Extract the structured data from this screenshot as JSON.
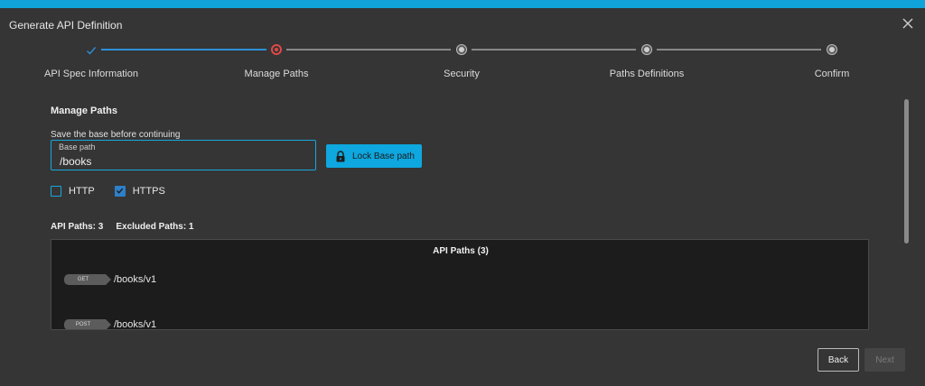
{
  "window": {
    "title": "Generate API Definition"
  },
  "stepper": {
    "steps": [
      {
        "label": "API Spec Information",
        "state": "done"
      },
      {
        "label": "Manage Paths",
        "state": "current"
      },
      {
        "label": "Security",
        "state": "pending"
      },
      {
        "label": "Paths Definitions",
        "state": "pending"
      },
      {
        "label": "Confirm",
        "state": "pending"
      }
    ]
  },
  "manage_paths": {
    "title": "Manage Paths",
    "helper": "Save the base before continuing",
    "base_path": {
      "label": "Base path",
      "value": "/books"
    },
    "lock_button": "Lock Base path",
    "schemes": [
      {
        "label": "HTTP",
        "checked": false
      },
      {
        "label": "HTTPS",
        "checked": true
      }
    ],
    "api_paths_count": "API Paths: 3",
    "excluded_paths_count": "Excluded Paths: 1",
    "paths_panel": {
      "title": "API Paths (3)",
      "items": [
        {
          "method": "GET",
          "path": "/books/v1"
        },
        {
          "method": "POST",
          "path": "/books/v1"
        }
      ]
    }
  },
  "footer": {
    "back": "Back",
    "next": "Next"
  },
  "colors": {
    "accent": "#0fa3d9",
    "error": "#e04848",
    "panel": "#1c1c1c",
    "background": "#353535"
  }
}
